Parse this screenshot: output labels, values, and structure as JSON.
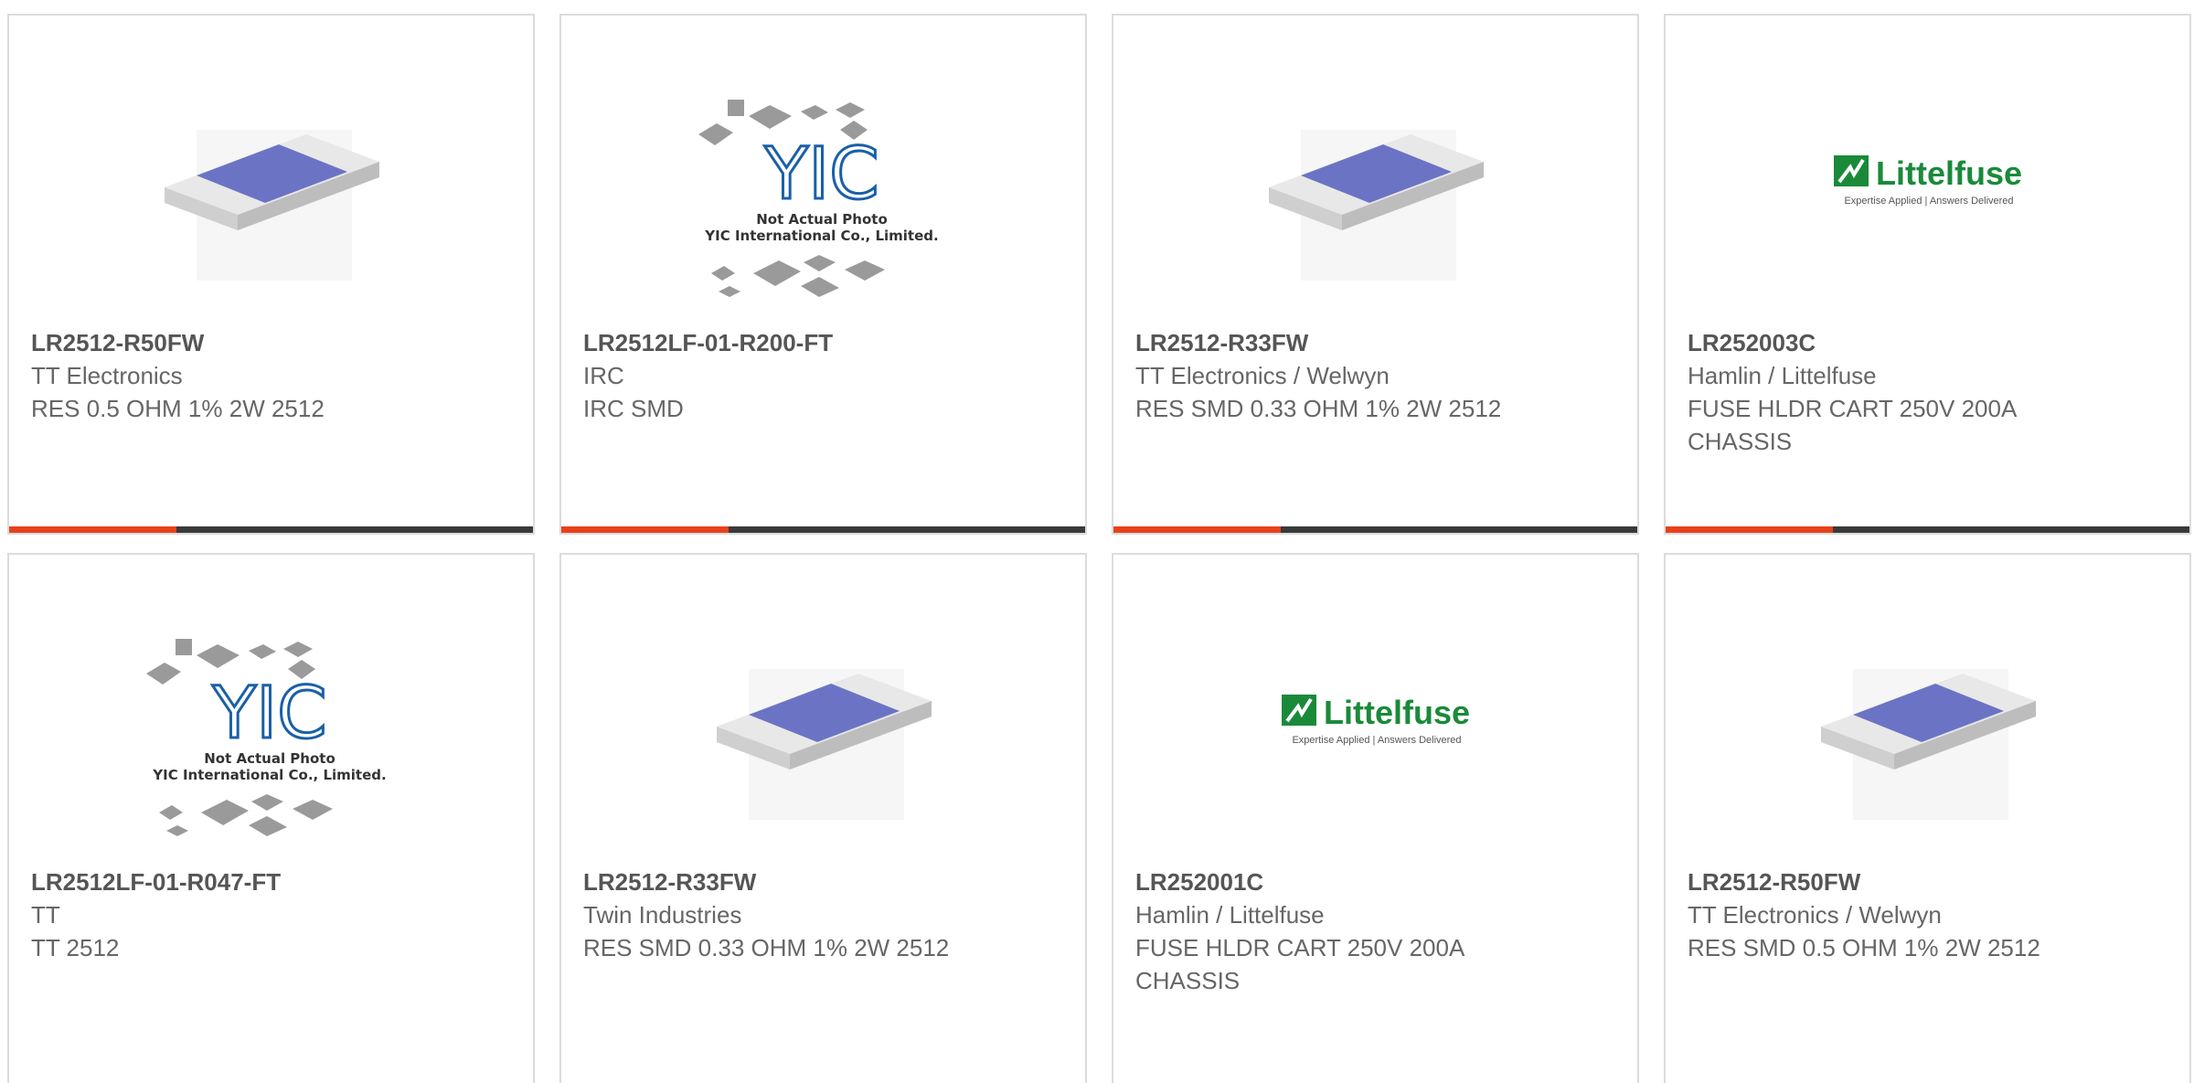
{
  "colors": {
    "accent": "#e8411a",
    "bar": "#3a3a3a",
    "resistor_blue": "#6b74c4",
    "littelfuse_green": "#1a8a3a",
    "yic_blue": "#1a5fa8"
  },
  "products": [
    {
      "part_number": "LR2512-R50FW",
      "manufacturer": "TT Electronics",
      "description": "RES 0.5 OHM 1% 2W 2512",
      "image": "resistor-chip-icon"
    },
    {
      "part_number": "LR2512LF-01-R200-FT",
      "manufacturer": "IRC",
      "description": "IRC SMD",
      "image": "yic-placeholder-image",
      "image_text": {
        "logo": "YIC",
        "line1": "Not Actual Photo",
        "line2": "YIC International Co., Limited."
      }
    },
    {
      "part_number": "LR2512-R33FW",
      "manufacturer": "TT Electronics / Welwyn",
      "description": "RES SMD 0.33 OHM 1% 2W 2512",
      "image": "resistor-chip-icon"
    },
    {
      "part_number": "LR252003C",
      "manufacturer": "Hamlin / Littelfuse",
      "description": "FUSE HLDR CART 250V 200A CHASSIS",
      "image": "littelfuse-logo",
      "image_text": {
        "brand": "Littelfuse",
        "tagline": "Expertise Applied | Answers Delivered"
      }
    },
    {
      "part_number": "LR2512LF-01-R047-FT",
      "manufacturer": "TT",
      "description": "TT 2512",
      "image": "yic-placeholder-image",
      "image_text": {
        "logo": "YIC",
        "line1": "Not Actual Photo",
        "line2": "YIC International Co., Limited."
      }
    },
    {
      "part_number": "LR2512-R33FW",
      "manufacturer": "Twin Industries",
      "description": "RES SMD 0.33 OHM 1% 2W 2512",
      "image": "resistor-chip-icon"
    },
    {
      "part_number": "LR252001C",
      "manufacturer": "Hamlin / Littelfuse",
      "description": "FUSE HLDR CART 250V 200A CHASSIS",
      "image": "littelfuse-logo",
      "image_text": {
        "brand": "Littelfuse",
        "tagline": "Expertise Applied | Answers Delivered"
      }
    },
    {
      "part_number": "LR2512-R50FW",
      "manufacturer": "TT Electronics / Welwyn",
      "description": "RES SMD 0.5 OHM 1% 2W 2512",
      "image": "resistor-chip-icon"
    }
  ]
}
